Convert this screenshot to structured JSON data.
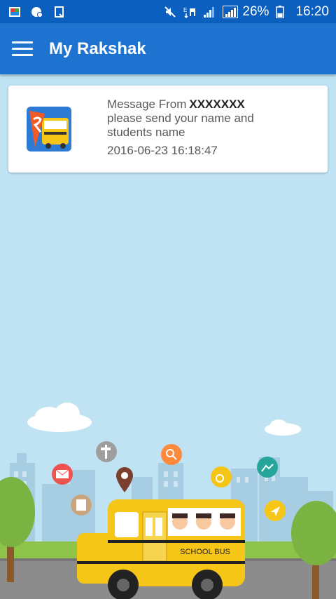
{
  "status_bar": {
    "battery": "26%",
    "time": "16:20"
  },
  "app_bar": {
    "title": "My Rakshak"
  },
  "message": {
    "from_prefix": "Message From",
    "sender": "XXXXXXX",
    "body_line1": "please send your name and",
    "body_line2": "students name",
    "timestamp": "2016-06-23 16:18:47"
  },
  "illustration": {
    "bus_label": "SCHOOL BUS"
  },
  "colors": {
    "status_bar": "#0b5fbf",
    "app_bar": "#1e73d1",
    "background": "#bfe3f3",
    "bus_yellow": "#f5c518"
  }
}
